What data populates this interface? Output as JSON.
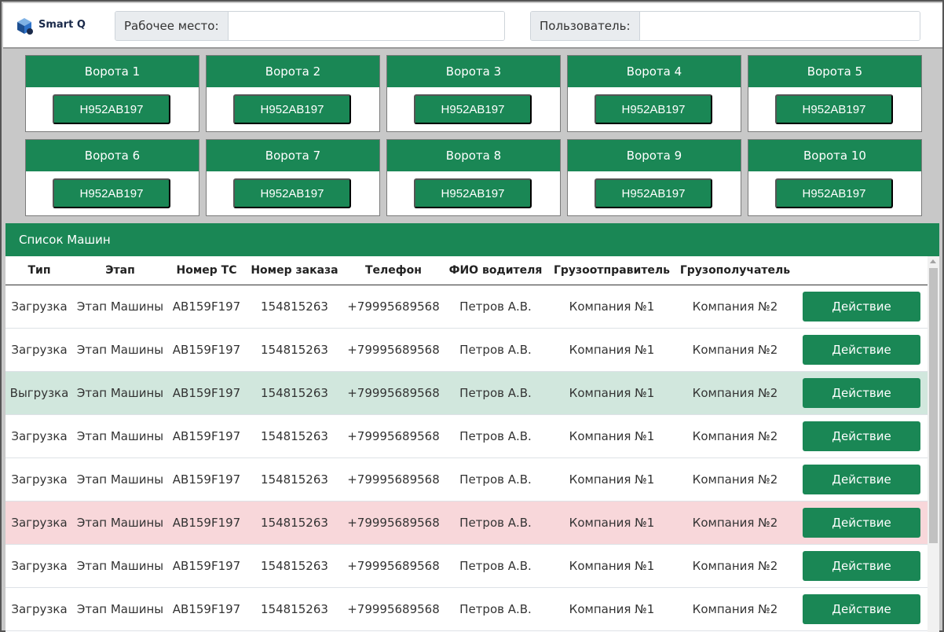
{
  "app": {
    "name": "Smart Q"
  },
  "header": {
    "workplace_label": "Рабочее место:",
    "workplace_value": "",
    "user_label": "Пользователь:",
    "user_value": ""
  },
  "gates": [
    {
      "title": "Ворота 1",
      "plate": "Н952АВ197"
    },
    {
      "title": "Ворота 2",
      "plate": "Н952АВ197"
    },
    {
      "title": "Ворота 3",
      "plate": "Н952АВ197"
    },
    {
      "title": "Ворота 4",
      "plate": "Н952АВ197"
    },
    {
      "title": "Ворота 5",
      "plate": "Н952АВ197"
    },
    {
      "title": "Ворота 6",
      "plate": "Н952АВ197"
    },
    {
      "title": "Ворота 7",
      "plate": "Н952АВ197"
    },
    {
      "title": "Ворота 8",
      "plate": "Н952АВ197"
    },
    {
      "title": "Ворота 9",
      "plate": "Н952АВ197"
    },
    {
      "title": "Ворота 10",
      "plate": "Н952АВ197"
    }
  ],
  "list": {
    "title": "Список Машин",
    "columns": [
      "Тип",
      "Этап",
      "Номер ТС",
      "Номер заказа",
      "Телефон",
      "ФИО водителя",
      "Грузоотправитель",
      "Грузополучатель",
      ""
    ],
    "rows": [
      {
        "type": "Загрузка",
        "stage": "Этап Машины",
        "vehicle": "АВ159F197",
        "order": "154815263",
        "phone": "+79995689568",
        "driver": "Петров А.В.",
        "shipper": "Компания №1",
        "consignee": "Компания №2",
        "action": "Действие",
        "highlight": ""
      },
      {
        "type": "Загрузка",
        "stage": "Этап Машины",
        "vehicle": "АВ159F197",
        "order": "154815263",
        "phone": "+79995689568",
        "driver": "Петров А.В.",
        "shipper": "Компания №1",
        "consignee": "Компания №2",
        "action": "Действие",
        "highlight": ""
      },
      {
        "type": "Выгрузка",
        "stage": "Этап Машины",
        "vehicle": "АВ159F197",
        "order": "154815263",
        "phone": "+79995689568",
        "driver": "Петров А.В.",
        "shipper": "Компания №1",
        "consignee": "Компания №2",
        "action": "Действие",
        "highlight": "green"
      },
      {
        "type": "Загрузка",
        "stage": "Этап Машины",
        "vehicle": "АВ159F197",
        "order": "154815263",
        "phone": "+79995689568",
        "driver": "Петров А.В.",
        "shipper": "Компания №1",
        "consignee": "Компания №2",
        "action": "Действие",
        "highlight": ""
      },
      {
        "type": "Загрузка",
        "stage": "Этап Машины",
        "vehicle": "АВ159F197",
        "order": "154815263",
        "phone": "+79995689568",
        "driver": "Петров А.В.",
        "shipper": "Компания №1",
        "consignee": "Компания №2",
        "action": "Действие",
        "highlight": ""
      },
      {
        "type": "Загрузка",
        "stage": "Этап Машины",
        "vehicle": "АВ159F197",
        "order": "154815263",
        "phone": "+79995689568",
        "driver": "Петров А.В.",
        "shipper": "Компания №1",
        "consignee": "Компания №2",
        "action": "Действие",
        "highlight": "red"
      },
      {
        "type": "Загрузка",
        "stage": "Этап Машины",
        "vehicle": "АВ159F197",
        "order": "154815263",
        "phone": "+79995689568",
        "driver": "Петров А.В.",
        "shipper": "Компания №1",
        "consignee": "Компания №2",
        "action": "Действие",
        "highlight": ""
      },
      {
        "type": "Загрузка",
        "stage": "Этап Машины",
        "vehicle": "АВ159F197",
        "order": "154815263",
        "phone": "+79995689568",
        "driver": "Петров А.В.",
        "shipper": "Компания №1",
        "consignee": "Компания №2",
        "action": "Действие",
        "highlight": ""
      }
    ]
  },
  "colors": {
    "accent": "#1a8755",
    "row_success": "#d1e7dd",
    "row_danger": "#f8d7da"
  },
  "icons": {
    "logo": "smart-q-logo-icon"
  }
}
